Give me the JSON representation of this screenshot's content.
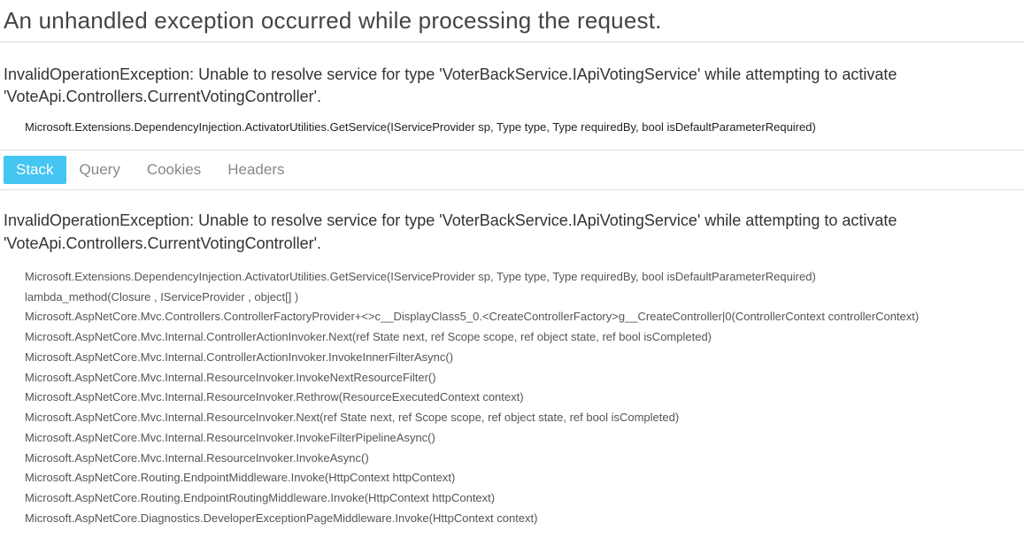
{
  "pageTitle": "An unhandled exception occurred while processing the request.",
  "exceptionSummary": "InvalidOperationException: Unable to resolve service for type 'VoterBackService.IApiVotingService' while attempting to activate 'VoteApi.Controllers.CurrentVotingController'.",
  "firstFrame": "Microsoft.Extensions.DependencyInjection.ActivatorUtilities.GetService(IServiceProvider sp, Type type, Type requiredBy, bool isDefaultParameterRequired)",
  "tabs": {
    "stack": "Stack",
    "query": "Query",
    "cookies": "Cookies",
    "headers": "Headers"
  },
  "stackPanel": {
    "exceptionMessage": "InvalidOperationException: Unable to resolve service for type 'VoterBackService.IApiVotingService' while attempting to activate 'VoteApi.Controllers.CurrentVotingController'.",
    "frames": [
      "Microsoft.Extensions.DependencyInjection.ActivatorUtilities.GetService(IServiceProvider sp, Type type, Type requiredBy, bool isDefaultParameterRequired)",
      "lambda_method(Closure , IServiceProvider , object[] )",
      "Microsoft.AspNetCore.Mvc.Controllers.ControllerFactoryProvider+<>c__DisplayClass5_0.<CreateControllerFactory>g__CreateController|0(ControllerContext controllerContext)",
      "Microsoft.AspNetCore.Mvc.Internal.ControllerActionInvoker.Next(ref State next, ref Scope scope, ref object state, ref bool isCompleted)",
      "Microsoft.AspNetCore.Mvc.Internal.ControllerActionInvoker.InvokeInnerFilterAsync()",
      "Microsoft.AspNetCore.Mvc.Internal.ResourceInvoker.InvokeNextResourceFilter()",
      "Microsoft.AspNetCore.Mvc.Internal.ResourceInvoker.Rethrow(ResourceExecutedContext context)",
      "Microsoft.AspNetCore.Mvc.Internal.ResourceInvoker.Next(ref State next, ref Scope scope, ref object state, ref bool isCompleted)",
      "Microsoft.AspNetCore.Mvc.Internal.ResourceInvoker.InvokeFilterPipelineAsync()",
      "Microsoft.AspNetCore.Mvc.Internal.ResourceInvoker.InvokeAsync()",
      "Microsoft.AspNetCore.Routing.EndpointMiddleware.Invoke(HttpContext httpContext)",
      "Microsoft.AspNetCore.Routing.EndpointRoutingMiddleware.Invoke(HttpContext httpContext)",
      "Microsoft.AspNetCore.Diagnostics.DeveloperExceptionPageMiddleware.Invoke(HttpContext context)"
    ]
  }
}
